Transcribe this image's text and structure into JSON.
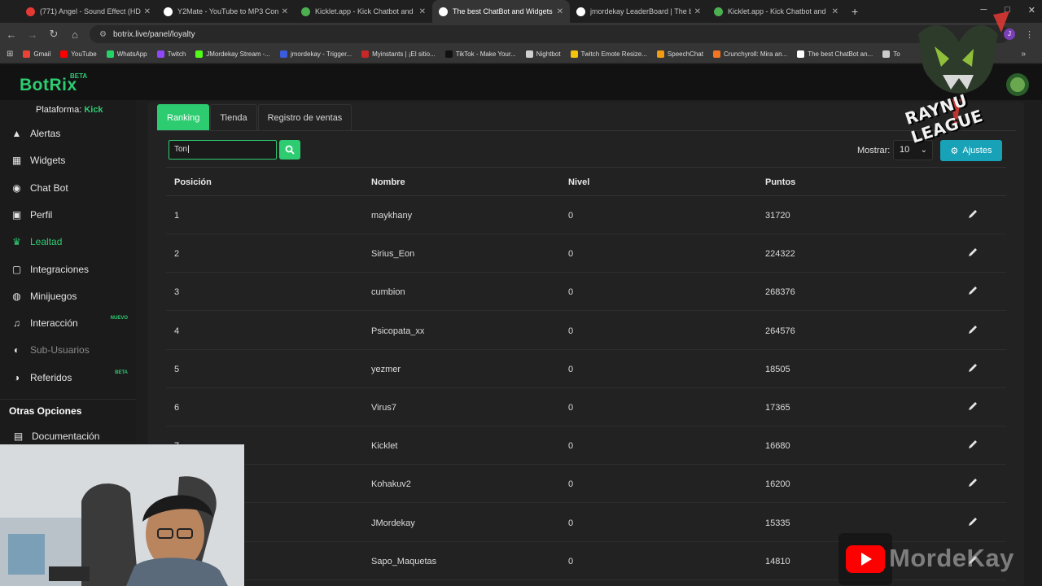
{
  "browser": {
    "tabs": [
      {
        "title": "(771) Angel - Sound Effect (HD",
        "color": "#e53935",
        "active": false
      },
      {
        "title": "Y2Mate - YouTube to MP3 Con",
        "color": "#ffffff",
        "active": false
      },
      {
        "title": "Kicklet.app - Kick Chatbot and",
        "color": "#4caf50",
        "active": false
      },
      {
        "title": "The best ChatBot and Widgets",
        "color": "#ffffff",
        "active": true
      },
      {
        "title": "jmordekay LeaderBoard | The b",
        "color": "#ffffff",
        "active": false
      },
      {
        "title": "Kicklet.app - Kick Chatbot and",
        "color": "#4caf50",
        "active": false
      }
    ],
    "url": "botrix.live/panel/loyalty",
    "profile_initial": "J",
    "bookmarks": [
      {
        "label": "Gmail",
        "color": "#ea4335"
      },
      {
        "label": "YouTube",
        "color": "#ff0000"
      },
      {
        "label": "WhatsApp",
        "color": "#25d366"
      },
      {
        "label": "Twitch",
        "color": "#9146ff"
      },
      {
        "label": "JMordekay Stream -...",
        "color": "#53fc18"
      },
      {
        "label": "jmordekay - Trigger...",
        "color": "#3b5bdb"
      },
      {
        "label": "Myinstants | ¡El sitio...",
        "color": "#c62828"
      },
      {
        "label": "TikTok - Make Your...",
        "color": "#111111"
      },
      {
        "label": "Nightbot",
        "color": "#cfcfcf"
      },
      {
        "label": "Twitch Emote Resize...",
        "color": "#f4c20d"
      },
      {
        "label": "SpeechChat",
        "color": "#f39c12"
      },
      {
        "label": "Crunchyroll: Mira an...",
        "color": "#f47521"
      },
      {
        "label": "The best ChatBot an...",
        "color": "#ffffff"
      },
      {
        "label": "To",
        "color": "#cccccc"
      }
    ]
  },
  "app": {
    "logo": "BotRix",
    "logo_badge": "BETA",
    "platform_label": "Plataforma:",
    "platform_value": "Kick"
  },
  "sidebar": {
    "items": [
      {
        "label": "Alertas",
        "icon": "warning-icon",
        "state": "normal"
      },
      {
        "label": "Widgets",
        "icon": "grid-icon",
        "state": "normal"
      },
      {
        "label": "Chat Bot",
        "icon": "robot-icon",
        "state": "normal"
      },
      {
        "label": "Perfil",
        "icon": "id-card-icon",
        "state": "normal"
      },
      {
        "label": "Lealtad",
        "icon": "trophy-icon",
        "state": "active"
      },
      {
        "label": "Integraciones",
        "icon": "integrations-icon",
        "state": "normal"
      },
      {
        "label": "Minijuegos",
        "icon": "gamepad-icon",
        "state": "normal"
      },
      {
        "label": "Interacción",
        "icon": "music-icon",
        "state": "normal",
        "badge": "NUEVO"
      },
      {
        "label": "Sub-Usuarios",
        "icon": "sub-users-icon",
        "state": "muted"
      },
      {
        "label": "Referidos",
        "icon": "users-icon",
        "state": "normal",
        "badge": "BETA"
      }
    ],
    "section_title": "Otras Opciones",
    "doc_label": "Documentación"
  },
  "tabs": [
    "Ranking",
    "Tienda",
    "Registro de ventas"
  ],
  "search": {
    "value": "Ton"
  },
  "controls": {
    "show_label": "Mostrar:",
    "show_value": "10",
    "settings_label": "Ajustes"
  },
  "table": {
    "headers": [
      "Posición",
      "Nombre",
      "Nivel",
      "Puntos"
    ],
    "rows": [
      {
        "pos": "1",
        "name": "maykhany",
        "level": "0",
        "points": "31720"
      },
      {
        "pos": "2",
        "name": "Sirius_Eon",
        "level": "0",
        "points": "224322"
      },
      {
        "pos": "3",
        "name": "cumbion",
        "level": "0",
        "points": "268376"
      },
      {
        "pos": "4",
        "name": "Psicopata_xx",
        "level": "0",
        "points": "264576"
      },
      {
        "pos": "5",
        "name": "yezmer",
        "level": "0",
        "points": "18505"
      },
      {
        "pos": "6",
        "name": "Virus7",
        "level": "0",
        "points": "17365"
      },
      {
        "pos": "7",
        "name": "Kicklet",
        "level": "0",
        "points": "16680"
      },
      {
        "pos": "",
        "name": "Kohakuv2",
        "level": "0",
        "points": "16200"
      },
      {
        "pos": "",
        "name": "JMordekay",
        "level": "0",
        "points": "15335"
      },
      {
        "pos": "",
        "name": "Sapo_Maquetas",
        "level": "0",
        "points": "14810"
      }
    ]
  },
  "overlay": {
    "league_text": "RAYNU LEAGUE",
    "channel_name": "MordeKay"
  },
  "colors": {
    "accent": "#2ecc71",
    "info": "#17a2b8"
  }
}
